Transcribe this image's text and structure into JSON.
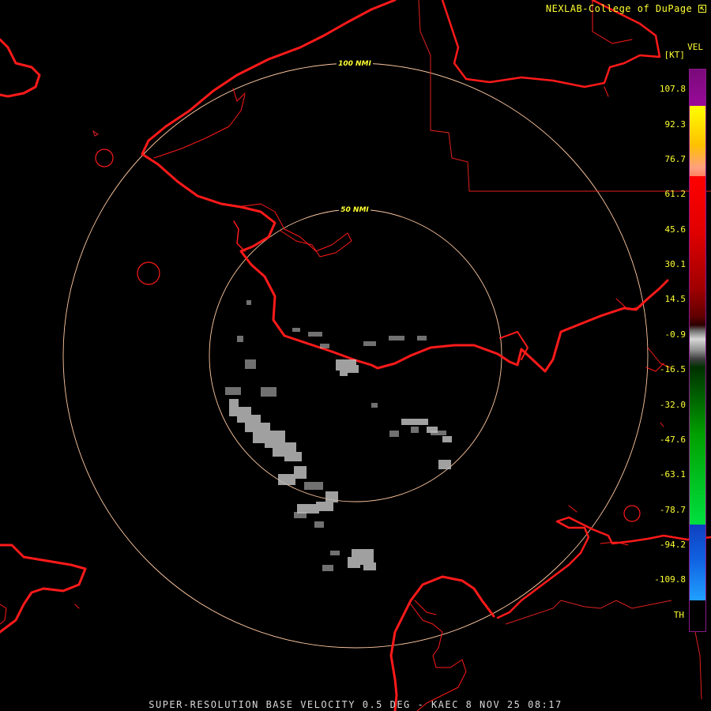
{
  "credit": "NEXLAB-College of DuPage",
  "credit_icon": "external-link-icon",
  "footer": "SUPER-RESOLUTION BASE VELOCITY 0.5 DEG - KAEC 8 NOV 25 08:17",
  "legend": {
    "product": "VEL",
    "units": "[KT]",
    "ticks": [
      "107.8",
      "92.3",
      "76.7",
      "61.2",
      "45.6",
      "30.1",
      "14.5",
      "-0.9",
      "-16.5",
      "-32.0",
      "-47.6",
      "-63.1",
      "-78.7",
      "-94.2",
      "-109.8",
      "TH"
    ]
  },
  "range_rings": [
    {
      "label": "100 NMI"
    },
    {
      "label": "50 NMI"
    }
  ],
  "colors": {
    "coastline": "#ff1a1a",
    "boundary": "#e02020",
    "range_ring": "#ffc8a0",
    "label_text": "#ffff33",
    "echo": "#bcbcbc"
  }
}
